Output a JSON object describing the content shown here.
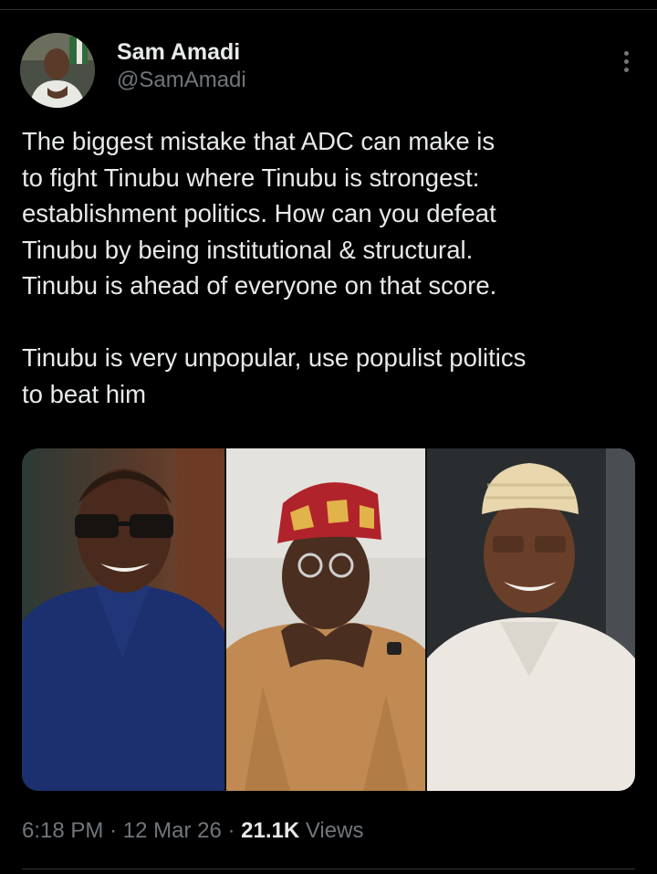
{
  "author": {
    "display_name": "Sam Amadi",
    "handle": "@SamAmadi"
  },
  "tweet": {
    "text": "The biggest mistake that ADC can make is\nto fight Tinubu where Tinubu is strongest:\nestablishment politics. How can you defeat\nTinubu by being institutional & structural.\nTinubu is ahead of everyone on that score.\n\nTinubu is very unpopular, use populist politics\nto beat him"
  },
  "meta": {
    "time": "6:18 PM",
    "separator": "·",
    "date": "12 Mar 26",
    "views_count": "21.1K",
    "views_label": "Views"
  },
  "icons": {
    "more": "more-vertical-icon"
  },
  "colors": {
    "background": "#000000",
    "text_primary": "#e7e9ea",
    "text_secondary": "#71767b",
    "divider": "#2f3336"
  }
}
